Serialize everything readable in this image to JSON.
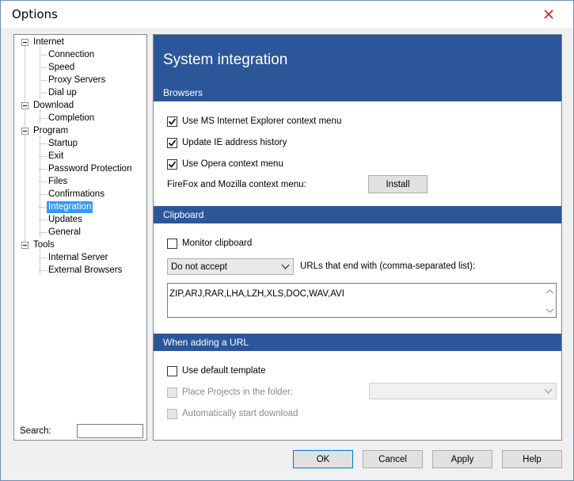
{
  "window": {
    "title": "Options"
  },
  "tree": {
    "items": [
      {
        "label": "Internet"
      },
      {
        "label": "Connection"
      },
      {
        "label": "Speed"
      },
      {
        "label": "Proxy Servers"
      },
      {
        "label": "Dial up"
      },
      {
        "label": "Download"
      },
      {
        "label": "Completion"
      },
      {
        "label": "Program"
      },
      {
        "label": "Startup"
      },
      {
        "label": "Exit"
      },
      {
        "label": "Password Protection"
      },
      {
        "label": "Files"
      },
      {
        "label": "Confirmations"
      },
      {
        "label": "Integration"
      },
      {
        "label": "Updates"
      },
      {
        "label": "General"
      },
      {
        "label": "Tools"
      },
      {
        "label": "Internal Server"
      },
      {
        "label": "External Browsers"
      }
    ],
    "selected": "Integration"
  },
  "search": {
    "label": "Search:",
    "value": ""
  },
  "content": {
    "title": "System integration",
    "browsers": {
      "header": "Browsers",
      "ie_context": {
        "label": "Use MS Internet Explorer context menu",
        "checked": true
      },
      "ie_history": {
        "label": "Update IE address history",
        "checked": true
      },
      "opera_context": {
        "label": "Use Opera context menu",
        "checked": true
      },
      "firefox_label": "FireFox and Mozilla context menu:",
      "install_button": "Install"
    },
    "clipboard": {
      "header": "Clipboard",
      "monitor": {
        "label": "Monitor clipboard",
        "checked": false
      },
      "accept_select": "Do not accept",
      "urls_label": "URLs that end with (comma-separated list):",
      "extensions": "ZIP,ARJ,RAR,LHA,LZH,XLS,DOC,WAV,AVI"
    },
    "adding_url": {
      "header": "When adding a URL",
      "default_template": {
        "label": "Use default template",
        "checked": false
      },
      "place_projects": {
        "label": "Place Projects in the folder:",
        "checked": false,
        "disabled": true
      },
      "folder_select": "",
      "auto_start": {
        "label": "Automatically start download",
        "checked": false,
        "disabled": true
      }
    }
  },
  "buttons": {
    "ok": "OK",
    "cancel": "Cancel",
    "apply": "Apply",
    "help": "Help"
  },
  "colors": {
    "accent": "#2b579a",
    "selection": "#3399ff",
    "close_icon": "#e81123"
  }
}
